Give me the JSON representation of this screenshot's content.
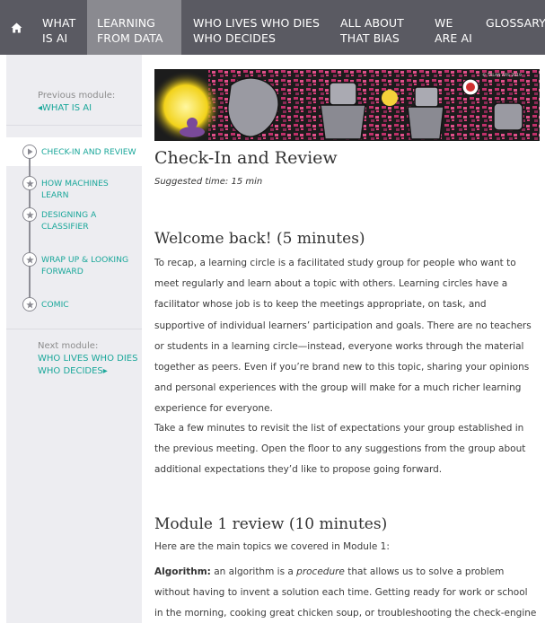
{
  "nav": {
    "home_icon": "home-icon",
    "items": [
      {
        "line1": "WHAT",
        "line2": "IS AI"
      },
      {
        "line1": "LEARNING",
        "line2": "FROM DATA"
      },
      {
        "line1": "WHO LIVES WHO DIES",
        "line2": "WHO DECIDES"
      },
      {
        "line1": "ALL ABOUT",
        "line2": "THAT BIAS"
      },
      {
        "line1": "WE",
        "line2": "ARE AI"
      },
      {
        "line1": "GLOSSARY",
        "line2": ""
      }
    ],
    "active_color": "#8a8a90",
    "bar_color": "#5a5a62"
  },
  "sidebar": {
    "previous": {
      "caption": "Previous module:",
      "name": "◂WHAT IS AI"
    },
    "items": [
      {
        "label": "CHECK-IN AND REVIEW",
        "icon": "play-icon"
      },
      {
        "label": "HOW MACHINES LEARN",
        "icon": "star-icon"
      },
      {
        "label": "DESIGNING A CLASSIFIER",
        "icon": "star-icon"
      },
      {
        "label": "WRAP UP & LOOKING FORWARD",
        "icon": "star-icon"
      },
      {
        "label": "COMIC",
        "icon": "star-icon"
      }
    ],
    "next": {
      "caption": "Next module:",
      "name_line1": "WHO LIVES WHO DIES",
      "name_line2": "WHO DECIDES▸"
    },
    "accent": "#1aa79a"
  },
  "main": {
    "title": "Check-In and Review",
    "subtitle": "Suggested time: 15 min",
    "section1": {
      "heading": "Welcome back! (5 minutes)",
      "p1": "To recap, a learning circle is a facilitated study group for people who want to meet regularly and learn about a topic with others. Learning circles have a facilitator whose job is to keep the meetings appropriate, on task, and supportive of individual learners’ participation and goals. There are no teachers or students in a learning circle—instead, everyone works through the material together as peers. Even if you’re brand new to this topic, sharing your opinions and personal experiences with the group will make for a much richer learning experience for everyone.",
      "p2": "Take a few minutes to revisit the list of expectations your group established in the previous meeting. Open the floor to any suggestions from the group about additional expectations they’d like to propose going forward."
    },
    "section2": {
      "heading": "Module 1 review (10 minutes)",
      "intro": "Here are the main topics we covered in Module 1:",
      "term": "Algorithm:",
      "def_a": " an algorithm is a ",
      "def_em": "procedure",
      "def_b": " that allows us to solve a problem without having to invent a solution each time. Getting ready for work or school in the morning, cooking great chicken soup, or troubleshooting the check-engine light in"
    },
    "banner_signature": "© TALAN ARS 2019"
  }
}
